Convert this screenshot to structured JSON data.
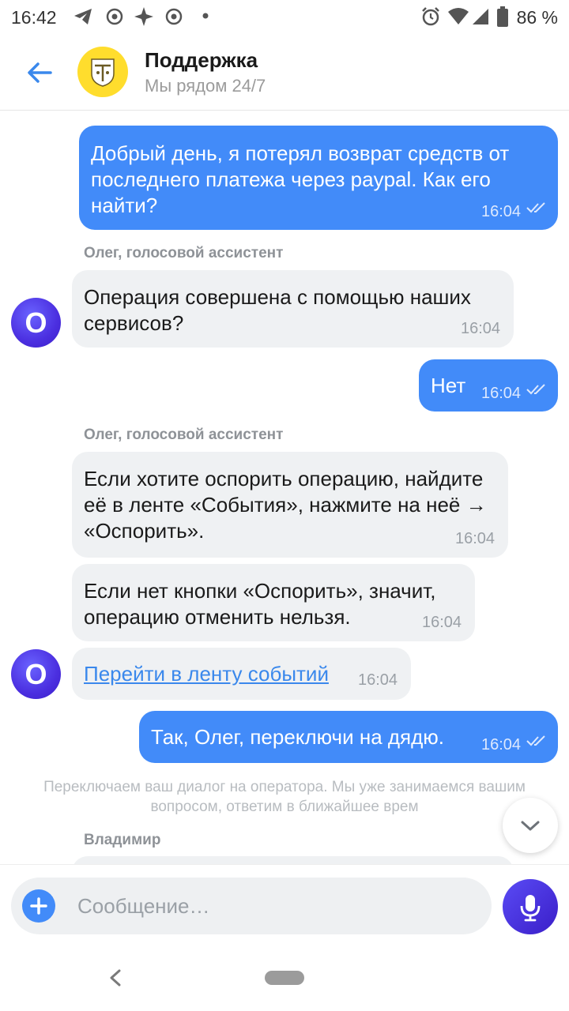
{
  "status_bar": {
    "time": "16:42",
    "battery": "86 %",
    "icons": [
      "telegram-icon",
      "app-icon",
      "sparkle-icon",
      "app-icon",
      "dot-icon",
      "alarm-icon",
      "wifi-icon",
      "signal-icon",
      "battery-icon"
    ]
  },
  "header": {
    "title": "Поддержка",
    "subtitle": "Мы рядом 24/7"
  },
  "messages": [
    {
      "from": "user",
      "text": "Добрый день, я потерял возврат средств от последнего платежа через paypal. Как его найти?",
      "time": "16:04"
    },
    {
      "from": "bot",
      "sender": "Олег, голосовой ассистент",
      "text": "Операция совершена с помощью наших сервисов?",
      "time": "16:04"
    },
    {
      "from": "user",
      "text": "Нет",
      "time": "16:04"
    },
    {
      "from": "bot",
      "sender": "Олег, голосовой ассистент",
      "text": "Если хотите оспорить операцию, найдите её в ленте «События», нажмите на неё → «Оспорить».",
      "time": "16:04"
    },
    {
      "from": "bot",
      "text": "Если нет кнопки «Оспорить», значит, операцию отменить нельзя.",
      "time": "16:04"
    },
    {
      "from": "bot",
      "text": "Перейти в ленту событий",
      "time": "16:04"
    },
    {
      "from": "user",
      "text": "Так, Олег, переключи на дядю.",
      "time": "16:04"
    }
  ],
  "bot_avatar_letter": "О",
  "system_note": "Переключаем ваш диалог на оператора. Мы уже занимаемся вашим вопросом, ответим в ближайшее врем",
  "operator_name": "Владимир",
  "input": {
    "placeholder": "Сообщение…"
  },
  "colors": {
    "accent": "#428bf9",
    "brand_yellow": "#ffdd2d",
    "bot_avatar": "#4b2fe0",
    "incoming_bubble": "#eff1f3"
  }
}
